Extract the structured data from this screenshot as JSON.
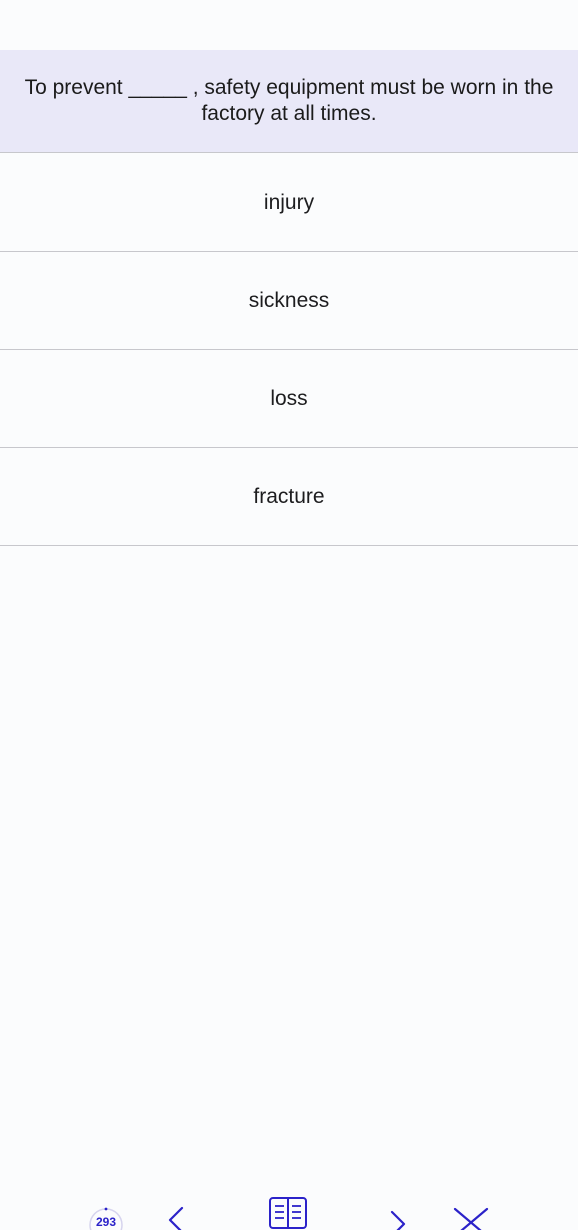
{
  "question": {
    "text": "To prevent _____ , safety equipment must be worn in the factory at all times."
  },
  "options": [
    {
      "label": "injury"
    },
    {
      "label": "sickness"
    },
    {
      "label": "loss"
    },
    {
      "label": "fracture"
    }
  ],
  "toolbar": {
    "counter": "293",
    "icons": [
      "progress-counter",
      "chevron-left-icon",
      "book-icon",
      "chevron-right-icon",
      "close-icon"
    ],
    "accent_color": "#2b22c9"
  },
  "colors": {
    "question_background": "#e9e8f8",
    "page_background": "#fbfcfd",
    "divider": "#c7c7cc"
  }
}
